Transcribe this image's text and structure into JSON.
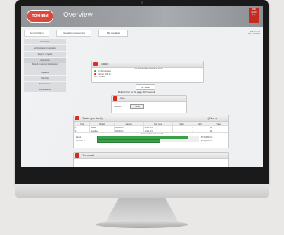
{
  "header": {
    "logo": "TOKHEIM",
    "title": "Overview",
    "user": [
      "Wi-Fi",
      "Logoff",
      "Help"
    ]
  },
  "tabs": [
    {
      "label": "Administration"
    },
    {
      "label": "Operating management"
    },
    {
      "label": "Site operating"
    }
  ],
  "build": [
    "BOS Ver. 4.2",
    "Date: 1/2/2011"
  ],
  "sidebar": [
    "Initialization",
    "Administration organisation",
    "Reports / Imports",
    "Operations",
    "Shop & Customer Relationship",
    "Inspection",
    "Security",
    "Maintenance",
    "Miscellaneous"
  ],
  "status_panel": {
    "title": "Status",
    "rows": [
      "OK Active. Date: 10/09/2011 10:48",
      "On the business",
      "Closing: shift 10",
      "Open by BOS"
    ],
    "button": "OK Status"
  },
  "shift_caption": "Refresh time for the page: 600 Seconds",
  "site_panel": {
    "title": "Site",
    "field_label": "Selection",
    "field_value": "Todos"
  },
  "tanks_panel": {
    "title": "Tanks (per tank)",
    "tag": "(31 cm)",
    "columns": [
      "Tank",
      "Product",
      "Capacity",
      "Tank value",
      "Water",
      "Alarm",
      "Status"
    ],
    "rows": [
      [
        "1",
        "Diesel",
        "30000.00 L",
        "26543.00 L",
        "-",
        "-",
        "Ok"
      ],
      [
        "2",
        "Gasoline",
        "30000.00 L",
        "18432.00 L",
        "-",
        "-",
        "Ok"
      ]
    ],
    "levels_caption": "Consumption level per tank",
    "levels": [
      {
        "label": "Diesel 1",
        "pct": 88,
        "text": "88 % (26543 L)"
      },
      {
        "label": "Gasoline 2",
        "pct": 61,
        "text": "61 % (18432 L)"
      }
    ]
  },
  "terminals_panel": {
    "title": "Terminals"
  }
}
